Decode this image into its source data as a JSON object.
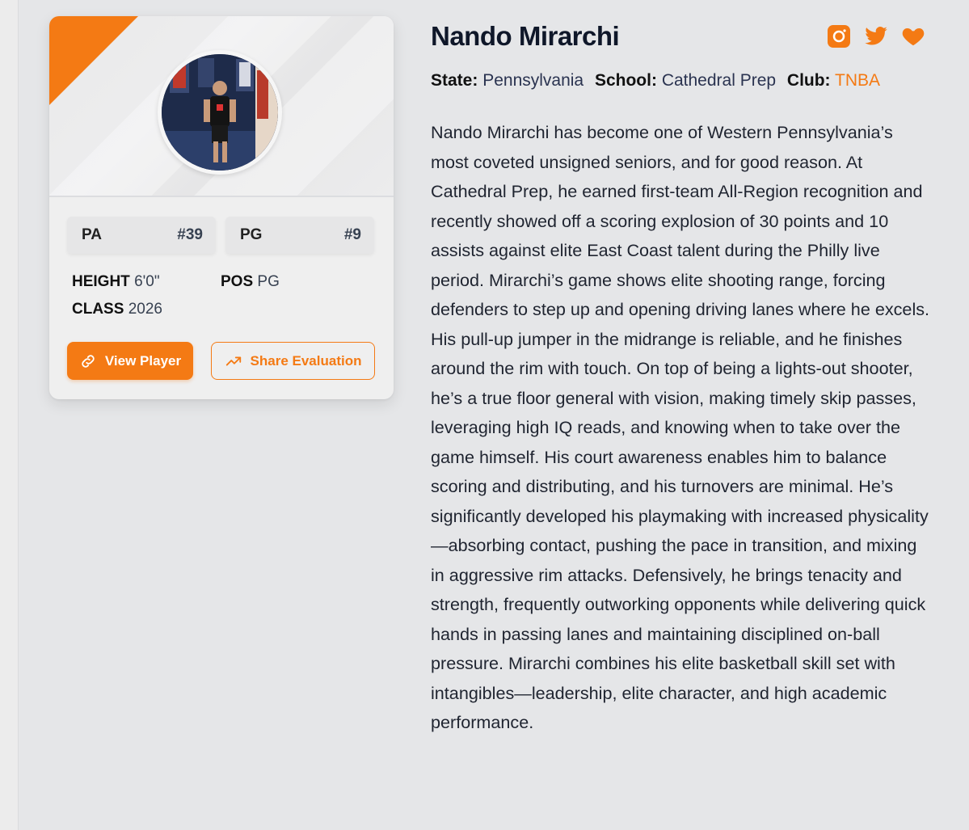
{
  "player": {
    "name": "Nando Mirarchi",
    "state_label": "State:",
    "state": "Pennsylvania",
    "school_label": "School:",
    "school": "Cathedral Prep",
    "club_label": "Club:",
    "club": "TNBA",
    "bio": "Nando Mirarchi has become one of Western Pennsylvania’s most coveted unsigned seniors, and for good reason. At Cathedral Prep, he earned first-team All-Region recognition and recently showed off a scoring explosion of 30 points and 10 assists against elite East Coast talent during the Philly live period. Mirarchi’s game shows elite shooting range, forcing defenders to step up and opening driving lanes where he excels. His pull-up jumper in the midrange is reliable, and he finishes around the rim with touch. On top of being a lights-out shooter, he’s a true floor general with vision, making timely skip passes, leveraging high IQ reads, and knowing when to take over the game himself. His court awareness enables him to balance scoring and distributing, and his turnovers are minimal. He’s significantly developed his playmaking with increased physicality—absorbing contact, pushing the pace in transition, and mixing in aggressive rim attacks. Defensively, he brings tenacity and strength, frequently outworking opponents while delivering quick hands in passing lanes and maintaining disciplined on-ball pressure. Mirarchi combines his elite basketball skill set with intangibles—leadership, elite character, and high academic performance."
  },
  "card": {
    "chips": [
      {
        "label": "PA",
        "value": "#39"
      },
      {
        "label": "PG",
        "value": "#9"
      }
    ],
    "stats": {
      "height_label": "HEIGHT",
      "height": "6'0\"",
      "pos_label": "POS",
      "pos": "PG",
      "class_label": "CLASS",
      "class": "2026"
    },
    "buttons": {
      "view_player": "View Player",
      "share_evaluation": "Share Evaluation"
    }
  },
  "socials": [
    "instagram-icon",
    "twitter-icon",
    "heart-icon"
  ],
  "colors": {
    "accent": "#f47a14",
    "background": "#e5e6e8",
    "card": "#efefef",
    "text": "#1f2430"
  }
}
